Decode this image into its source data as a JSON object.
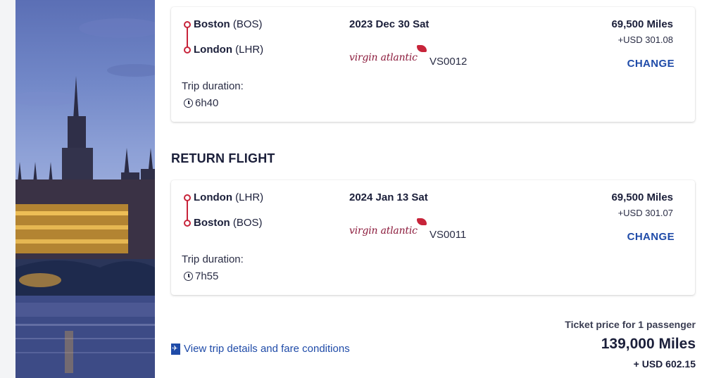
{
  "outbound": {
    "origin_city": "Boston",
    "origin_code": "(BOS)",
    "dest_city": "London",
    "dest_code": "(LHR)",
    "date": "2023 Dec 30 Sat",
    "airline_logo_text": "virgin atlantic",
    "flight_number": "VS0012",
    "duration_label": "Trip duration:",
    "duration": "6h40",
    "miles": "69,500 Miles",
    "usd": "+USD 301.08",
    "change_label": "CHANGE"
  },
  "return_section_title": "RETURN FLIGHT",
  "return": {
    "origin_city": "London",
    "origin_code": "(LHR)",
    "dest_city": "Boston",
    "dest_code": "(BOS)",
    "date": "2024 Jan 13 Sat",
    "airline_logo_text": "virgin atlantic",
    "flight_number": "VS0011",
    "duration_label": "Trip duration:",
    "duration": "7h55",
    "miles": "69,500 Miles",
    "usd": "+USD 301.07",
    "change_label": "CHANGE"
  },
  "footer": {
    "details_link": "View trip details and fare conditions",
    "ticket_label": "Ticket price for 1 passenger",
    "total_miles": "139,000 Miles",
    "total_usd": "+ USD 602.15"
  },
  "colors": {
    "route_line": "#c7243a",
    "link_blue": "#1f4ba8",
    "text_dark": "#1b1f3a"
  },
  "icons": [
    "clock-icon",
    "plane-icon",
    "virgin-atlantic-logo"
  ]
}
